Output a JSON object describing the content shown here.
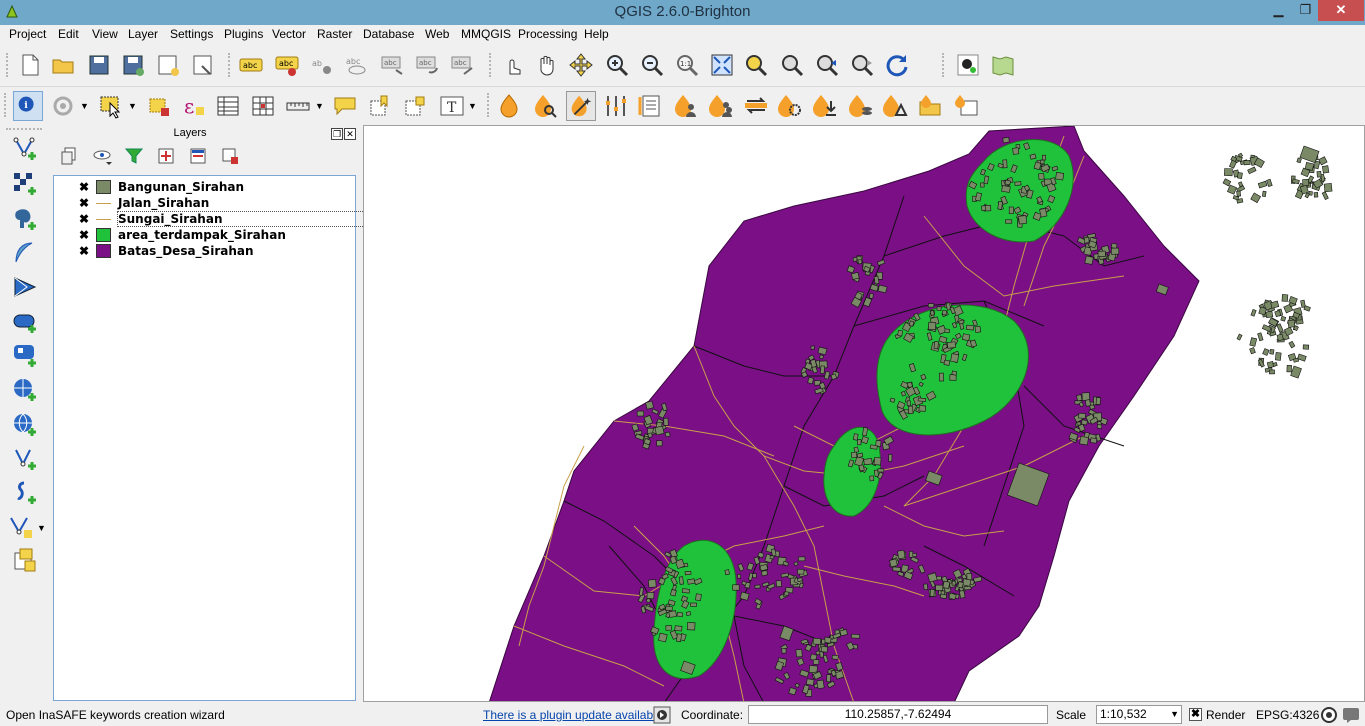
{
  "window": {
    "title": "QGIS 2.6.0-Brighton",
    "minimize": "▁",
    "maximize": "❐",
    "close": "✕"
  },
  "menu": [
    "Project",
    "Edit",
    "View",
    "Layer",
    "Settings",
    "Plugins",
    "Vector",
    "Raster",
    "Database",
    "Web",
    "MMQGIS",
    "Processing",
    "Help"
  ],
  "icons": {
    "toolbar1": [
      "new-project-icon",
      "open-project-icon",
      "save-project-icon",
      "save-as-icon",
      "new-print-composer-icon",
      "composer-manager-icon",
      "label-abc-icon",
      "layer-labeling-icon",
      "pin-labels-icon",
      "show-hide-labels-icon",
      "move-label-icon",
      "rotate-label-icon",
      "change-label-icon",
      "touch-zoom-icon",
      "pan-icon",
      "pan-to-selection-icon",
      "zoom-in-icon",
      "zoom-out-icon",
      "zoom-native-icon",
      "zoom-full-icon",
      "zoom-to-selection-icon",
      "zoom-to-layer-icon",
      "zoom-last-icon",
      "zoom-next-icon",
      "refresh-icon",
      "georeferencer-icon",
      "openlayers-icon"
    ],
    "toolbar2": [
      "identify-icon",
      "feature-action-icon",
      "select-feature-icon",
      "deselect-icon",
      "field-calculator-icon",
      "attribute-table-icon",
      "statistics-icon",
      "measure-icon",
      "map-tips-icon",
      "new-bookmark-icon",
      "show-bookmarks-icon",
      "text-annotation-icon",
      "inasafe-dock-icon",
      "inasafe-keywords-icon",
      "inasafe-wizard-icon",
      "inasafe-impact-functions-icon",
      "inasafe-minimum-needs-icon",
      "inasafe-population-icon",
      "inasafe-batch-icon",
      "inasafe-save-scenario-icon",
      "inasafe-options-icon",
      "inasafe-osm-download-icon",
      "inasafe-converter-icon",
      "inasafe-shakemap-icon",
      "inasafe-field-mapping-icon",
      "inasafe-extent-icon"
    ],
    "left": [
      "add-vector-layer-icon",
      "add-raster-layer-icon",
      "add-postgis-layer-icon",
      "add-spatialite-layer-icon",
      "add-mssql-layer-icon",
      "add-oracle-layer-icon",
      "add-wms-layer-icon",
      "add-wcs-layer-icon",
      "add-wfs-layer-icon",
      "add-delimited-text-icon",
      "new-shapefile-icon",
      "add-virtual-layer-icon"
    ]
  },
  "layers_panel": {
    "title": "Layers",
    "layers": [
      {
        "name": "Bangunan_Sirahan",
        "checked": "✖",
        "symbol": "fill",
        "color": "#7a8a66"
      },
      {
        "name": "Jalan_Sirahan",
        "checked": "✖",
        "symbol": "line",
        "color": "#c8a04a"
      },
      {
        "name": "Sungai_Sirahan",
        "checked": "✖",
        "symbol": "line",
        "color": "#c8a04a"
      },
      {
        "name": "area_terdampak_Sirahan",
        "checked": "✖",
        "symbol": "fill",
        "color": "#1fc23a"
      },
      {
        "name": "Batas_Desa_Sirahan",
        "checked": "✖",
        "symbol": "fill",
        "color": "#7a0f86"
      }
    ]
  },
  "map_colors": {
    "village": "#7a0f86",
    "impact_area": "#1fc23a",
    "building": "#7a8a66",
    "road": "#c8a04a"
  },
  "status": {
    "message": "Open InaSAFE keywords creation wizard",
    "plugin_update": "There is a plugin update available",
    "coordinate_label": "Coordinate:",
    "coordinate_value": "110.25857,-7.62494",
    "scale_label": "Scale",
    "scale_value": "1:10,532",
    "render_checked": "✖",
    "render_label": "Render",
    "crs": "EPSG:4326"
  }
}
